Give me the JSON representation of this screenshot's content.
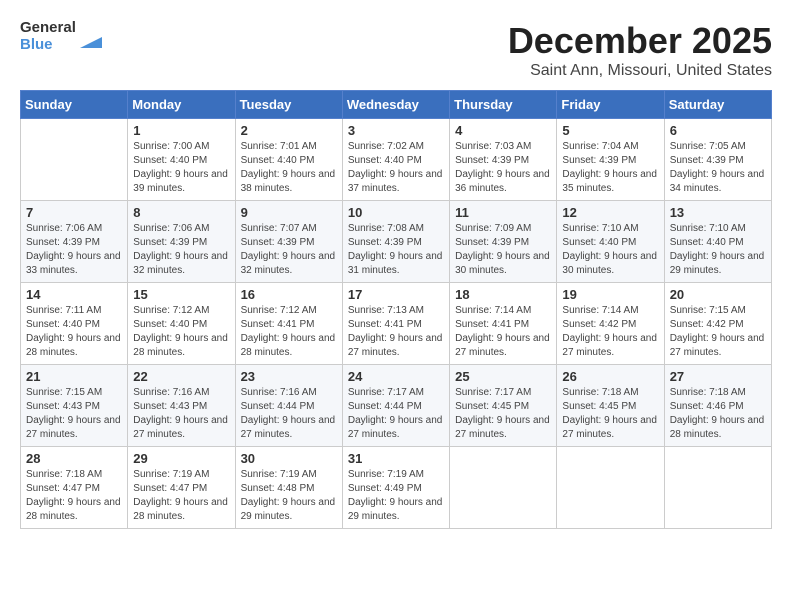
{
  "header": {
    "logo_line1": "General",
    "logo_line2": "Blue",
    "month": "December 2025",
    "location": "Saint Ann, Missouri, United States"
  },
  "days_of_week": [
    "Sunday",
    "Monday",
    "Tuesday",
    "Wednesday",
    "Thursday",
    "Friday",
    "Saturday"
  ],
  "weeks": [
    [
      {
        "day": "",
        "sunrise": "",
        "sunset": "",
        "daylight": ""
      },
      {
        "day": "1",
        "sunrise": "Sunrise: 7:00 AM",
        "sunset": "Sunset: 4:40 PM",
        "daylight": "Daylight: 9 hours and 39 minutes."
      },
      {
        "day": "2",
        "sunrise": "Sunrise: 7:01 AM",
        "sunset": "Sunset: 4:40 PM",
        "daylight": "Daylight: 9 hours and 38 minutes."
      },
      {
        "day": "3",
        "sunrise": "Sunrise: 7:02 AM",
        "sunset": "Sunset: 4:40 PM",
        "daylight": "Daylight: 9 hours and 37 minutes."
      },
      {
        "day": "4",
        "sunrise": "Sunrise: 7:03 AM",
        "sunset": "Sunset: 4:39 PM",
        "daylight": "Daylight: 9 hours and 36 minutes."
      },
      {
        "day": "5",
        "sunrise": "Sunrise: 7:04 AM",
        "sunset": "Sunset: 4:39 PM",
        "daylight": "Daylight: 9 hours and 35 minutes."
      },
      {
        "day": "6",
        "sunrise": "Sunrise: 7:05 AM",
        "sunset": "Sunset: 4:39 PM",
        "daylight": "Daylight: 9 hours and 34 minutes."
      }
    ],
    [
      {
        "day": "7",
        "sunrise": "Sunrise: 7:06 AM",
        "sunset": "Sunset: 4:39 PM",
        "daylight": "Daylight: 9 hours and 33 minutes."
      },
      {
        "day": "8",
        "sunrise": "Sunrise: 7:06 AM",
        "sunset": "Sunset: 4:39 PM",
        "daylight": "Daylight: 9 hours and 32 minutes."
      },
      {
        "day": "9",
        "sunrise": "Sunrise: 7:07 AM",
        "sunset": "Sunset: 4:39 PM",
        "daylight": "Daylight: 9 hours and 32 minutes."
      },
      {
        "day": "10",
        "sunrise": "Sunrise: 7:08 AM",
        "sunset": "Sunset: 4:39 PM",
        "daylight": "Daylight: 9 hours and 31 minutes."
      },
      {
        "day": "11",
        "sunrise": "Sunrise: 7:09 AM",
        "sunset": "Sunset: 4:39 PM",
        "daylight": "Daylight: 9 hours and 30 minutes."
      },
      {
        "day": "12",
        "sunrise": "Sunrise: 7:10 AM",
        "sunset": "Sunset: 4:40 PM",
        "daylight": "Daylight: 9 hours and 30 minutes."
      },
      {
        "day": "13",
        "sunrise": "Sunrise: 7:10 AM",
        "sunset": "Sunset: 4:40 PM",
        "daylight": "Daylight: 9 hours and 29 minutes."
      }
    ],
    [
      {
        "day": "14",
        "sunrise": "Sunrise: 7:11 AM",
        "sunset": "Sunset: 4:40 PM",
        "daylight": "Daylight: 9 hours and 28 minutes."
      },
      {
        "day": "15",
        "sunrise": "Sunrise: 7:12 AM",
        "sunset": "Sunset: 4:40 PM",
        "daylight": "Daylight: 9 hours and 28 minutes."
      },
      {
        "day": "16",
        "sunrise": "Sunrise: 7:12 AM",
        "sunset": "Sunset: 4:41 PM",
        "daylight": "Daylight: 9 hours and 28 minutes."
      },
      {
        "day": "17",
        "sunrise": "Sunrise: 7:13 AM",
        "sunset": "Sunset: 4:41 PM",
        "daylight": "Daylight: 9 hours and 27 minutes."
      },
      {
        "day": "18",
        "sunrise": "Sunrise: 7:14 AM",
        "sunset": "Sunset: 4:41 PM",
        "daylight": "Daylight: 9 hours and 27 minutes."
      },
      {
        "day": "19",
        "sunrise": "Sunrise: 7:14 AM",
        "sunset": "Sunset: 4:42 PM",
        "daylight": "Daylight: 9 hours and 27 minutes."
      },
      {
        "day": "20",
        "sunrise": "Sunrise: 7:15 AM",
        "sunset": "Sunset: 4:42 PM",
        "daylight": "Daylight: 9 hours and 27 minutes."
      }
    ],
    [
      {
        "day": "21",
        "sunrise": "Sunrise: 7:15 AM",
        "sunset": "Sunset: 4:43 PM",
        "daylight": "Daylight: 9 hours and 27 minutes."
      },
      {
        "day": "22",
        "sunrise": "Sunrise: 7:16 AM",
        "sunset": "Sunset: 4:43 PM",
        "daylight": "Daylight: 9 hours and 27 minutes."
      },
      {
        "day": "23",
        "sunrise": "Sunrise: 7:16 AM",
        "sunset": "Sunset: 4:44 PM",
        "daylight": "Daylight: 9 hours and 27 minutes."
      },
      {
        "day": "24",
        "sunrise": "Sunrise: 7:17 AM",
        "sunset": "Sunset: 4:44 PM",
        "daylight": "Daylight: 9 hours and 27 minutes."
      },
      {
        "day": "25",
        "sunrise": "Sunrise: 7:17 AM",
        "sunset": "Sunset: 4:45 PM",
        "daylight": "Daylight: 9 hours and 27 minutes."
      },
      {
        "day": "26",
        "sunrise": "Sunrise: 7:18 AM",
        "sunset": "Sunset: 4:45 PM",
        "daylight": "Daylight: 9 hours and 27 minutes."
      },
      {
        "day": "27",
        "sunrise": "Sunrise: 7:18 AM",
        "sunset": "Sunset: 4:46 PM",
        "daylight": "Daylight: 9 hours and 28 minutes."
      }
    ],
    [
      {
        "day": "28",
        "sunrise": "Sunrise: 7:18 AM",
        "sunset": "Sunset: 4:47 PM",
        "daylight": "Daylight: 9 hours and 28 minutes."
      },
      {
        "day": "29",
        "sunrise": "Sunrise: 7:19 AM",
        "sunset": "Sunset: 4:47 PM",
        "daylight": "Daylight: 9 hours and 28 minutes."
      },
      {
        "day": "30",
        "sunrise": "Sunrise: 7:19 AM",
        "sunset": "Sunset: 4:48 PM",
        "daylight": "Daylight: 9 hours and 29 minutes."
      },
      {
        "day": "31",
        "sunrise": "Sunrise: 7:19 AM",
        "sunset": "Sunset: 4:49 PM",
        "daylight": "Daylight: 9 hours and 29 minutes."
      },
      {
        "day": "",
        "sunrise": "",
        "sunset": "",
        "daylight": ""
      },
      {
        "day": "",
        "sunrise": "",
        "sunset": "",
        "daylight": ""
      },
      {
        "day": "",
        "sunrise": "",
        "sunset": "",
        "daylight": ""
      }
    ]
  ]
}
